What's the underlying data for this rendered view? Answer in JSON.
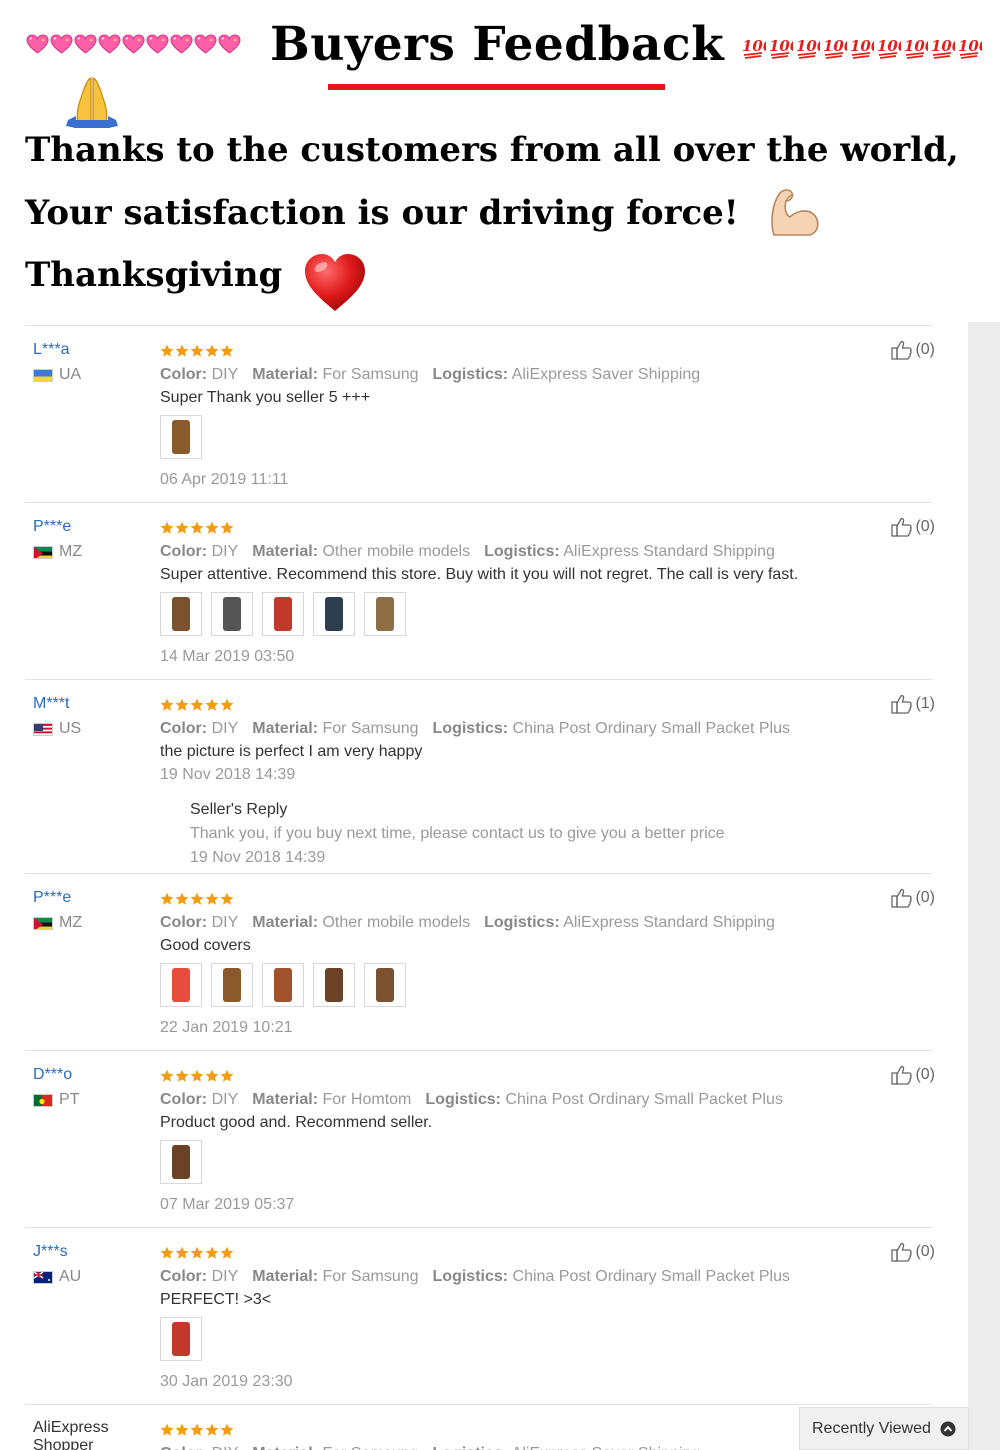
{
  "header": {
    "title": "Buyers Feedback",
    "line1": "Thanks to the customers from all over the world,",
    "line2": "Your satisfaction is our driving force!",
    "line3": "Thanksgiving",
    "decor_hearts_count": 9,
    "decor_hundred_count": 9,
    "icons": [
      "sparkling-heart-icon",
      "hundred-points-icon",
      "praying-hands-icon",
      "flexed-biceps-icon",
      "red-heart-icon"
    ]
  },
  "labels": {
    "color": "Color:",
    "material": "Material:",
    "logistics": "Logistics:",
    "seller_reply": "Seller's Reply"
  },
  "reviews": [
    {
      "user": "L***a",
      "country": "UA",
      "stars": 5,
      "color": "DIY",
      "material": "For Samsung",
      "logistics": "AliExpress Saver Shipping",
      "comment": "Super Thank you seller 5 +++",
      "photos": 1,
      "date": "06 Apr 2019 11:11",
      "likes": "(0)"
    },
    {
      "user": "P***e",
      "country": "MZ",
      "stars": 5,
      "color": "DIY",
      "material": "Other mobile models",
      "logistics": "AliExpress Standard Shipping",
      "comment": "Super attentive. Recommend this store. Buy with it you will not regret. The call is very fast.",
      "photos": 5,
      "date": "14 Mar 2019 03:50",
      "likes": "(0)"
    },
    {
      "user": "M***t",
      "country": "US",
      "stars": 5,
      "color": "DIY",
      "material": "For Samsung",
      "logistics": "China Post Ordinary Small Packet Plus",
      "comment": "the picture is perfect I am very happy",
      "photos": 0,
      "date": "19 Nov 2018 14:39",
      "likes": "(1)",
      "reply": {
        "text": "Thank you, if you buy next time, please contact us to give you a better price",
        "date": "19 Nov 2018 14:39"
      }
    },
    {
      "user": "P***e",
      "country": "MZ",
      "stars": 5,
      "color": "DIY",
      "material": "Other mobile models",
      "logistics": "AliExpress Standard Shipping",
      "comment": "Good covers",
      "photos": 5,
      "date": "22 Jan 2019 10:21",
      "likes": "(0)"
    },
    {
      "user": "D***o",
      "country": "PT",
      "stars": 5,
      "color": "DIY",
      "material": "For Homtom",
      "logistics": "China Post Ordinary Small Packet Plus",
      "comment": "Product good and. Recommend seller.",
      "photos": 1,
      "date": "07 Mar 2019 05:37",
      "likes": "(0)"
    },
    {
      "user": "J***s",
      "country": "AU",
      "stars": 5,
      "color": "DIY",
      "material": "For Samsung",
      "logistics": "China Post Ordinary Small Packet Plus",
      "comment": "PERFECT! >3<",
      "photos": 1,
      "date": "30 Jan 2019 23:30",
      "likes": "(0)"
    },
    {
      "user": "AliExpress Shopper",
      "country": "",
      "stars": 5,
      "color": "DIY",
      "material": "For Samsung",
      "logistics": "AliExpress Saver Shipping",
      "comment": "",
      "photos": 0,
      "date": "",
      "likes": ""
    }
  ],
  "recently_viewed": "Recently Viewed",
  "colors": {
    "username": "#2a6bc0",
    "star": "#f39c12",
    "title_underline": "#e8121a"
  }
}
